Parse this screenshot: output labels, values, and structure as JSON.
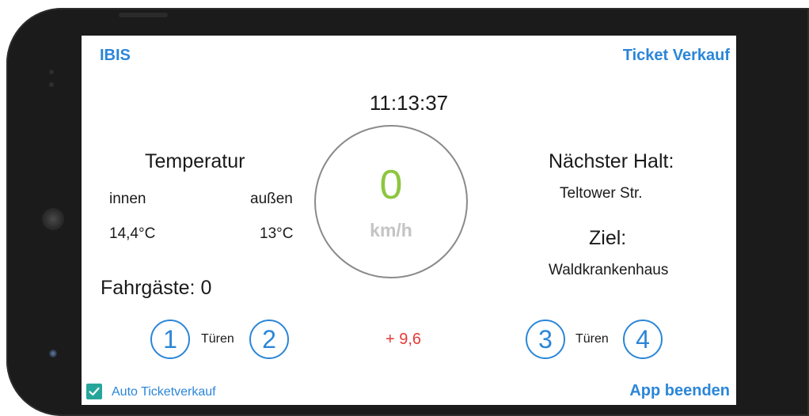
{
  "header": {
    "ibis_label": "IBIS",
    "ticket_label": "Ticket Verkauf"
  },
  "clock": {
    "time": "11:13:37"
  },
  "temperature": {
    "title": "Temperatur",
    "inside_label": "innen",
    "outside_label": "außen",
    "inside_value": "14,4°C",
    "outside_value": "13°C"
  },
  "passengers": {
    "label": "Fahrgäste: 0"
  },
  "speed": {
    "value": "0",
    "unit": "km/h",
    "delta": "+ 9,6"
  },
  "stops": {
    "next_title": "Nächster Halt:",
    "next_value": "Teltower Str.",
    "destination_title": "Ziel:",
    "destination_value": "Waldkrankenhaus"
  },
  "doors": {
    "left_label": "Türen",
    "right_label": "Türen",
    "numbers": [
      "1",
      "2",
      "3",
      "4"
    ]
  },
  "footer": {
    "auto_ticket_label": "Auto Ticketverkauf",
    "auto_ticket_checked": true,
    "exit_label": "App beenden"
  },
  "colors": {
    "accent_blue": "#2b86d8",
    "speed_green": "#8dc63f",
    "delta_red": "#e53935",
    "checkbox_teal": "#26a69a"
  }
}
